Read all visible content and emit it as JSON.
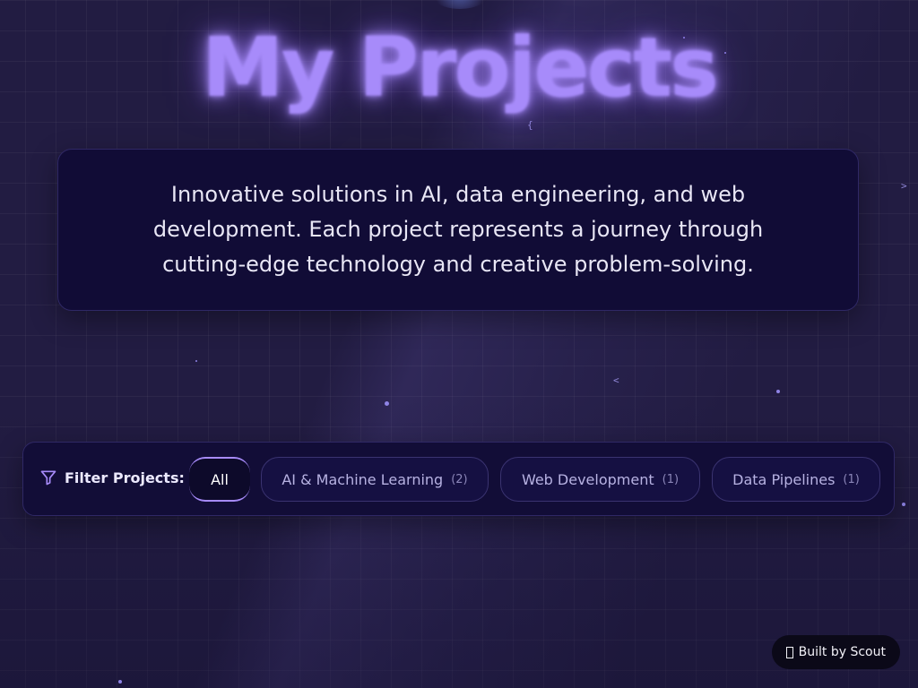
{
  "hero": {
    "title": "My Projects",
    "description": "Innovative solutions in AI, data engineering, and web development. Each project represents a journey through cutting-edge technology and creative problem-solving."
  },
  "filters": {
    "label": "Filter Projects:",
    "icon": "filter-icon",
    "options": [
      {
        "label": "All",
        "count": "",
        "active": true
      },
      {
        "label": "AI & Machine Learning",
        "count": "(2)",
        "active": false
      },
      {
        "label": "Web Development",
        "count": "(1)",
        "active": false
      },
      {
        "label": "Data Pipelines",
        "count": "(1)",
        "active": false
      }
    ]
  },
  "badge": {
    "label": "Built by Scout",
    "icon": "scout-icon"
  },
  "decor": {
    "glyphs": [
      "{",
      ">",
      "<",
      "<"
    ]
  },
  "colors": {
    "accent": "#a78bfa",
    "background": "#221c42",
    "card": "#110c36"
  }
}
